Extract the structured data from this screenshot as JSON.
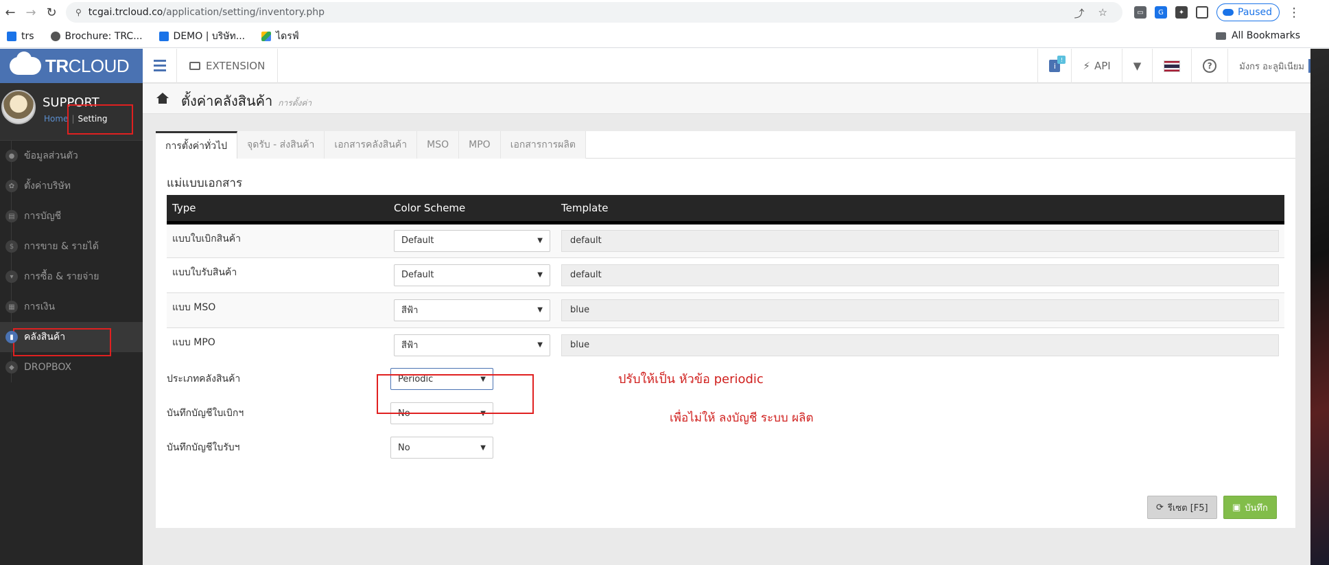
{
  "browser": {
    "url_domain": "tcgai.trcloud.co",
    "url_path": "/application/setting/inventory.php",
    "profile_status": "Paused"
  },
  "bookmarks": {
    "items": [
      {
        "label": "trs"
      },
      {
        "label": "Brochure: TRC..."
      },
      {
        "label": "DEMO | บริษัท..."
      },
      {
        "label": "ไดรฟ์"
      }
    ],
    "all_label": "All Bookmarks"
  },
  "sidebar": {
    "logo_bold": "TR",
    "logo_light": "CLOUD",
    "profile_name": "SUPPORT",
    "link_home": "Home",
    "link_setting": "Setting",
    "items": [
      {
        "label": "ข้อมูลส่วนตัว",
        "icon": "user-icon"
      },
      {
        "label": "ตั้งค่าบริษัท",
        "icon": "gear-icon"
      },
      {
        "label": "การบัญชี",
        "icon": "book-icon"
      },
      {
        "label": "การขาย & รายได้",
        "icon": "dollar-icon"
      },
      {
        "label": "การซื้อ & รายจ่าย",
        "icon": "cart-icon"
      },
      {
        "label": "การเงิน",
        "icon": "calendar-icon"
      },
      {
        "label": "คลังสินค้า",
        "icon": "chart-icon"
      },
      {
        "label": "DROPBOX",
        "icon": "dropbox-icon"
      }
    ]
  },
  "topbar": {
    "extension_label": "EXTENSION",
    "api_label": "API",
    "company_name": "มังกร อะลูมิเนียม"
  },
  "header": {
    "title": "ตั้งค่าคลังสินค้า",
    "subtitle": "การตั้งค่า"
  },
  "tabs": [
    {
      "label": "การตั้งค่าทั่วไป"
    },
    {
      "label": "จุดรับ - ส่งสินค้า"
    },
    {
      "label": "เอกสารคลังสินค้า"
    },
    {
      "label": "MSO"
    },
    {
      "label": "MPO"
    },
    {
      "label": "เอกสารการผลิต"
    }
  ],
  "main": {
    "section_title": "แม่แบบเอกสาร",
    "columns": [
      "Type",
      "Color Scheme",
      "Template"
    ],
    "rows": [
      {
        "type": "แบบใบเบิกสินค้า",
        "scheme": "Default",
        "template": "default"
      },
      {
        "type": "แบบใบรับสินค้า",
        "scheme": "Default",
        "template": "default"
      },
      {
        "type": "แบบ MSO",
        "scheme": "สีฟ้า",
        "template": "blue"
      },
      {
        "type": "แบบ MPO",
        "scheme": "สีฟ้า",
        "template": "blue"
      }
    ],
    "fields": [
      {
        "label": "ประเภทคลังสินค้า",
        "value": "Periodic"
      },
      {
        "label": "บันทึกบัญชีใบเบิกฯ",
        "value": "No"
      },
      {
        "label": "บันทึกบัญชีใบรับฯ",
        "value": "No"
      }
    ],
    "reset_label": "รีเซต [F5]",
    "save_label": "บันทึก"
  },
  "annotations": {
    "note1": "ปรับให้เป็น หัวข้อ   periodic",
    "note2": "เพื่อไม่ให้ ลงบัญชี ระบบ ผลิต"
  },
  "colors": {
    "brand_blue": "#4a72b2",
    "annotation_red": "#e02020",
    "save_green": "#82bd4a"
  }
}
